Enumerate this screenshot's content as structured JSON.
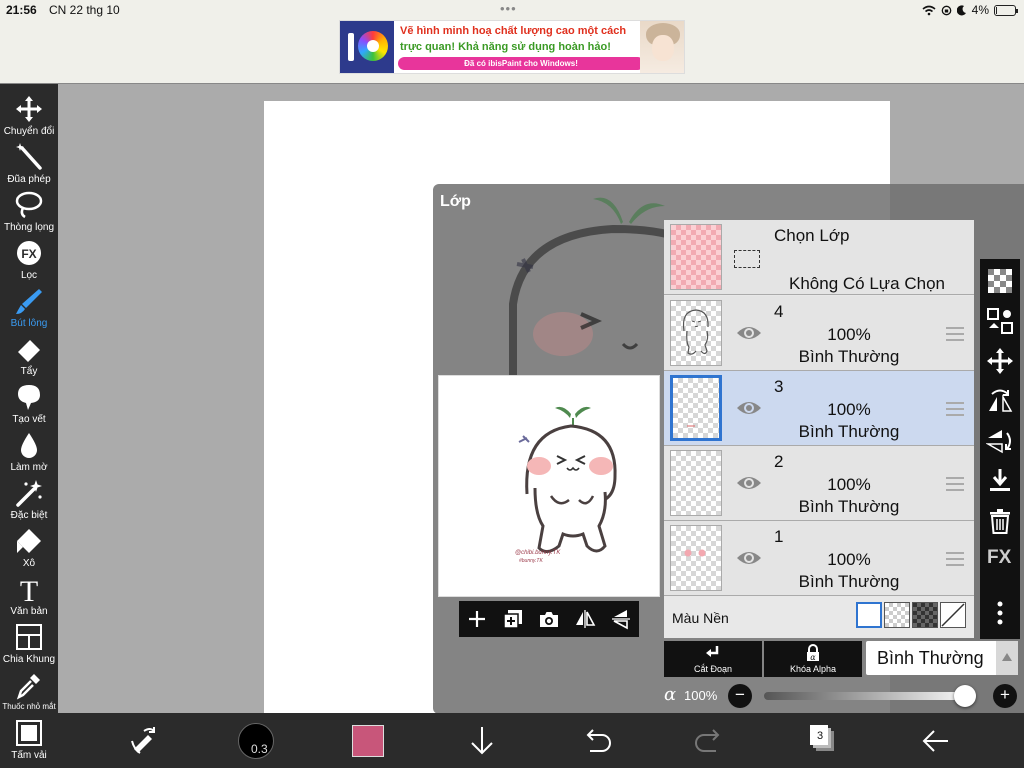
{
  "status": {
    "time": "21:56",
    "date": "CN 22 thg 10",
    "battery": "4%",
    "battery_level": 0.04
  },
  "ad": {
    "line1": "Vẽ hình minh hoạ chất lượng cao một cách",
    "line2": "trực quan! Khả năng sử dụng hoàn hảo!",
    "pill": "Đã có ibisPaint cho Windows!"
  },
  "tools": [
    {
      "label": "Chuyển đổi",
      "icon": "move-icon"
    },
    {
      "label": "Đũa phép",
      "icon": "magic-wand-icon"
    },
    {
      "label": "Thòng lọng",
      "icon": "lasso-icon"
    },
    {
      "label": "Lọc",
      "icon": "fx-icon"
    },
    {
      "label": "Bút lông",
      "icon": "brush-icon",
      "active": true
    },
    {
      "label": "Tẩy",
      "icon": "eraser-icon"
    },
    {
      "label": "Tạo vết",
      "icon": "smudge-icon"
    },
    {
      "label": "Làm mờ",
      "icon": "blur-icon"
    },
    {
      "label": "Đặc biệt",
      "icon": "special-icon"
    },
    {
      "label": "Xô",
      "icon": "bucket-icon"
    },
    {
      "label": "Văn bản",
      "icon": "text-icon"
    },
    {
      "label": "Chia Khung",
      "icon": "frame-icon"
    },
    {
      "label": "Thuốc nhỏ mắt",
      "icon": "eyedropper-icon"
    },
    {
      "label": "Tấm vải",
      "icon": "canvas-icon"
    }
  ],
  "layer_panel": {
    "title": "Lớp",
    "selection_layer": {
      "title": "Chọn Lớp",
      "status": "Không Có Lựa Chọn"
    },
    "layers": [
      {
        "number": "4",
        "opacity": "100%",
        "mode": "Bình Thường",
        "selected": false
      },
      {
        "number": "3",
        "opacity": "100%",
        "mode": "Bình Thường",
        "selected": true
      },
      {
        "number": "2",
        "opacity": "100%",
        "mode": "Bình Thường",
        "selected": false
      },
      {
        "number": "1",
        "opacity": "100%",
        "mode": "Bình Thường",
        "selected": false
      }
    ],
    "background": {
      "label": "Màu Nền"
    },
    "clip_label": "Cắt Đoạn",
    "alpha_lock_label": "Khóa Alpha",
    "blend_mode": "Bình Thường",
    "alpha_symbol": "α",
    "opacity": "100%",
    "opacity_level": 1.0,
    "side_fx": "FX"
  },
  "bottom": {
    "brush_size": "0.3",
    "color": "#c8567a",
    "layer_count": "3"
  },
  "colors": {
    "accent": "#3a9bf2",
    "selected_layer": "#ccd9ef",
    "selected_border": "#2f74d0"
  }
}
